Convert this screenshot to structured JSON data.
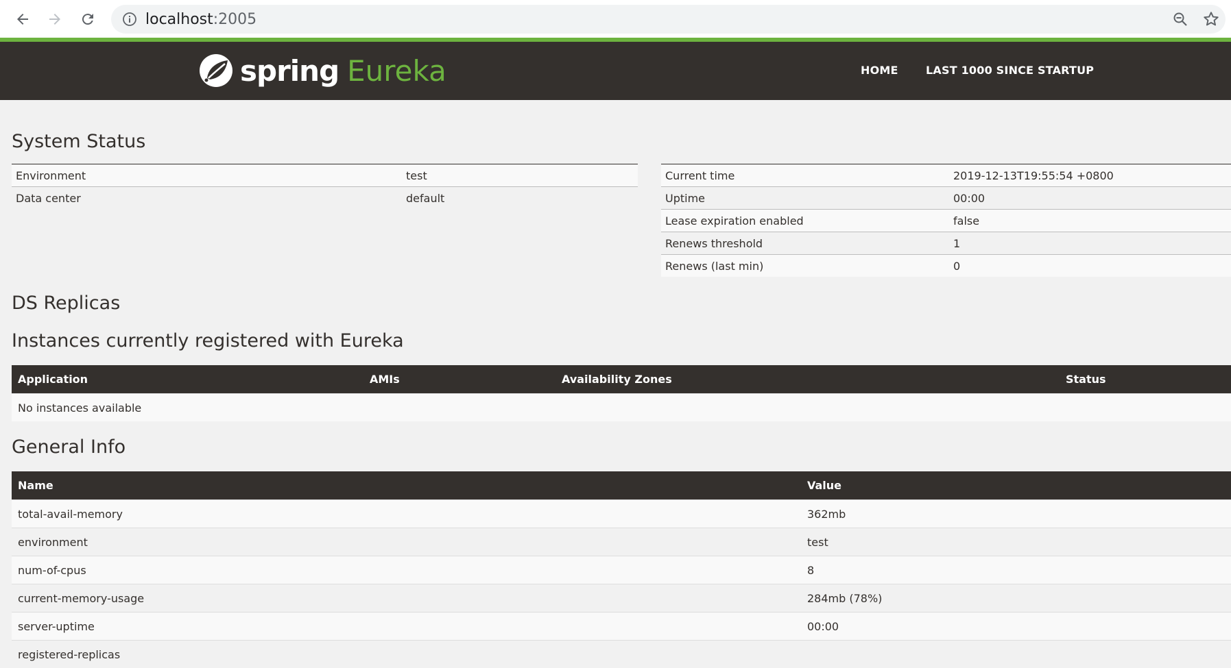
{
  "browser": {
    "url_host": "localhost",
    "url_port": ":2005"
  },
  "header": {
    "brand_spring": "spring",
    "brand_eureka": "Eureka",
    "nav": [
      "HOME",
      "LAST 1000 SINCE STARTUP"
    ]
  },
  "system_status": {
    "title": "System Status",
    "left": [
      {
        "label": "Environment",
        "value": "test"
      },
      {
        "label": "Data center",
        "value": "default"
      }
    ],
    "right": [
      {
        "label": "Current time",
        "value": "2019-12-13T19:55:54 +0800"
      },
      {
        "label": "Uptime",
        "value": "00:00"
      },
      {
        "label": "Lease expiration enabled",
        "value": "false"
      },
      {
        "label": "Renews threshold",
        "value": "1"
      },
      {
        "label": "Renews (last min)",
        "value": "0"
      }
    ]
  },
  "ds_replicas": {
    "title": "DS Replicas"
  },
  "instances": {
    "title": "Instances currently registered with Eureka",
    "headers": [
      "Application",
      "AMIs",
      "Availability Zones",
      "Status"
    ],
    "empty_message": "No instances available"
  },
  "general_info": {
    "title": "General Info",
    "headers": [
      "Name",
      "Value"
    ],
    "rows": [
      {
        "name": "total-avail-memory",
        "value": "362mb"
      },
      {
        "name": "environment",
        "value": "test"
      },
      {
        "name": "num-of-cpus",
        "value": "8"
      },
      {
        "name": "current-memory-usage",
        "value": "284mb (78%)"
      },
      {
        "name": "server-uptime",
        "value": "00:00"
      },
      {
        "name": "registered-replicas",
        "value": ""
      }
    ]
  },
  "colors": {
    "brand_green": "#6db33f",
    "header_dark": "#34302d",
    "page_bg": "#f1f1f1"
  }
}
